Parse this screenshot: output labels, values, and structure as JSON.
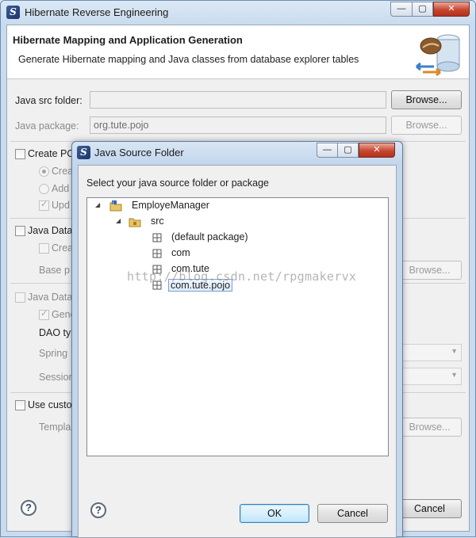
{
  "main_window": {
    "title": "Hibernate Reverse Engineering",
    "controls": {
      "minimize": "—",
      "maximize": "▢",
      "close": "✕"
    },
    "banner": {
      "title": "Hibernate Mapping and Application Generation",
      "description": "Generate Hibernate mapping and Java classes from database explorer tables"
    },
    "java_src_folder": {
      "label": "Java src folder:",
      "value": "",
      "browse": "Browse..."
    },
    "java_package": {
      "label": "Java package:",
      "value": "org.tute.pojo",
      "browse": "Browse..."
    },
    "create_pojo": {
      "label": "Create PO",
      "option1": "Crea",
      "option2": "Add",
      "option3": "Upd"
    },
    "java_data_1": {
      "label": "Java Data",
      "option": "Crea",
      "base_label": "Base p",
      "browse": "Browse..."
    },
    "java_data_2": {
      "label": "Java Data",
      "option": "Gene",
      "dao_type": "DAO ty",
      "spring": "Spring",
      "session": "Session"
    },
    "use_custom": {
      "label": "Use custo",
      "template_label": "Templa",
      "browse": "Browse..."
    },
    "cancel": "Cancel",
    "help": "?"
  },
  "dialog": {
    "title": "Java Source Folder",
    "controls": {
      "minimize": "—",
      "maximize": "▢",
      "close": "✕"
    },
    "prompt": "Select your java source folder or package",
    "tree": {
      "project": "EmployeManager",
      "folder": "src",
      "packages": [
        "(default package)",
        "com",
        "com.tute",
        "com.tute.pojo"
      ],
      "selected": "com.tute.pojo"
    },
    "ok": "OK",
    "cancel": "Cancel",
    "help": "?"
  },
  "watermark": "http://blog.csdn.net/rpgmakervx",
  "colors": {
    "title_bar": "#c9dbee",
    "close_button": "#c7462f",
    "selection": "#dcebfc",
    "primary_button": "#bee6fd"
  }
}
